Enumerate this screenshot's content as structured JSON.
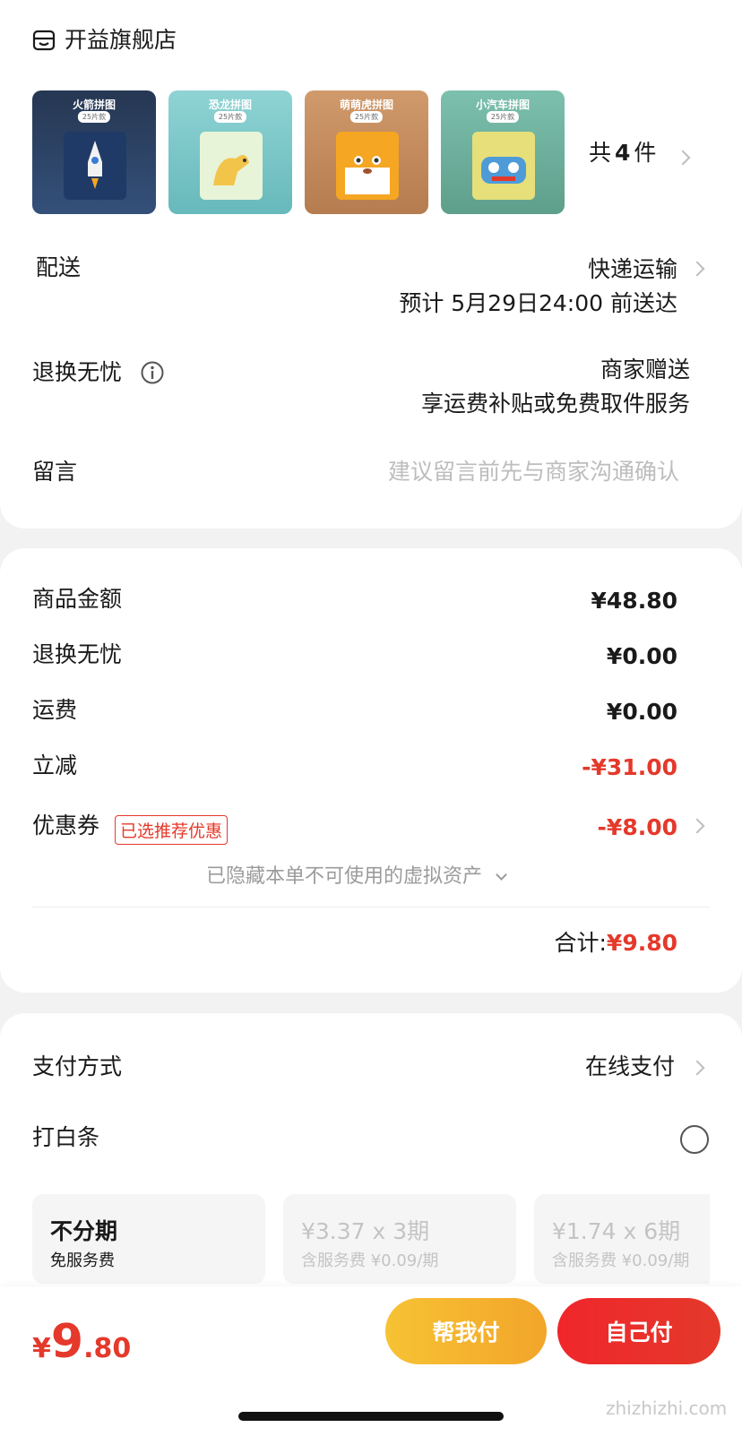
{
  "store": {
    "icon": "store-icon",
    "name": "开益旗舰店"
  },
  "products": [
    {
      "title": "火箭拼图",
      "sub": "25片款",
      "color": "#2b3f5c"
    },
    {
      "title": "恐龙拼图",
      "sub": "25片款",
      "color": "#7fc8c9"
    },
    {
      "title": "萌萌虎拼图",
      "sub": "25片款",
      "color": "#c48f62"
    },
    {
      "title": "小汽车拼图",
      "sub": "25片款",
      "color": "#6fb19e"
    }
  ],
  "product_count_label": "共",
  "product_count": "4",
  "product_count_unit": "件",
  "delivery": {
    "label": "配送",
    "method": "快递运输",
    "eta": "预计 5月29日24:00 前送达"
  },
  "return_service": {
    "label": "退换无忧",
    "value": "商家赠送",
    "desc": "享运费补贴或免费取件服务"
  },
  "message": {
    "label": "留言",
    "placeholder": "建议留言前先与商家沟通确认"
  },
  "summary": {
    "rows": [
      {
        "label": "商品金额",
        "value": "¥48.80"
      },
      {
        "label": "退换无忧",
        "value": "¥0.00"
      },
      {
        "label": "运费",
        "value": "¥0.00"
      },
      {
        "label": "立减",
        "value": "-¥31.00"
      }
    ],
    "coupon": {
      "label": "优惠券",
      "tag": "已选推荐优惠",
      "value": "-¥8.00"
    },
    "hidden_note": "已隐藏本单不可使用的虚拟资产",
    "total_label": "合计:",
    "total_value": "¥9.80"
  },
  "payment": {
    "label": "支付方式",
    "method": "在线支付",
    "baitiao_label": "打白条",
    "installments": [
      {
        "title": "不分期",
        "sub": "免服务费"
      },
      {
        "title": "¥3.37 x 3期",
        "sub": "含服务费 ¥0.09/期"
      },
      {
        "title": "¥1.74 x 6期",
        "sub": "含服务费 ¥0.09/期"
      }
    ]
  },
  "footer": {
    "currency": "¥",
    "price_int": "9",
    "price_dec": ".80",
    "help_pay": "帮我付",
    "self_pay": "自己付"
  },
  "watermark": "zhizhizhi.com",
  "colors": {
    "accent_red": "#e4392b",
    "help_pay_yellow": "#f5b52b"
  }
}
